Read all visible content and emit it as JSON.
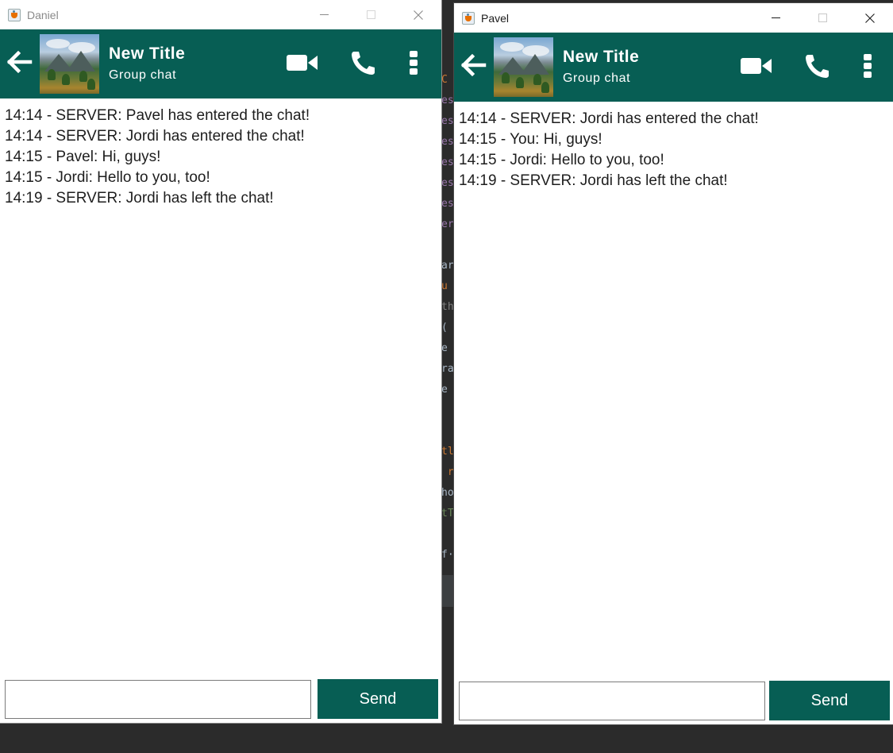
{
  "windows": [
    {
      "title": "Daniel",
      "chat": {
        "title": "New Title",
        "subtitle": "Group chat"
      },
      "messages": [
        "14:14 - SERVER: Pavel has entered the chat!",
        "14:14 - SERVER: Jordi has entered the chat!",
        "14:15 - Pavel: Hi, guys!",
        "14:15 - Jordi: Hello to you, too!",
        "14:19 - SERVER: Jordi has left the chat!"
      ],
      "input": {
        "value": "",
        "placeholder": ""
      },
      "send_label": "Send"
    },
    {
      "title": "Pavel",
      "chat": {
        "title": "New Title",
        "subtitle": "Group chat"
      },
      "messages": [
        "14:14 - SERVER: Jordi has entered the chat!",
        "14:15 - You: Hi, guys!",
        "14:15 - Jordi: Hello to you, too!",
        "14:19 - SERVER: Jordi has left the chat!"
      ],
      "input": {
        "value": "",
        "placeholder": ""
      },
      "send_label": "Send"
    }
  ],
  "colors": {
    "accent": "#075e54",
    "header_text": "#ffffff"
  },
  "icons": [
    "java-app-icon",
    "minimize-icon",
    "maximize-icon",
    "close-icon",
    "back-arrow-icon",
    "video-call-icon",
    "phone-call-icon",
    "more-options-icon"
  ]
}
